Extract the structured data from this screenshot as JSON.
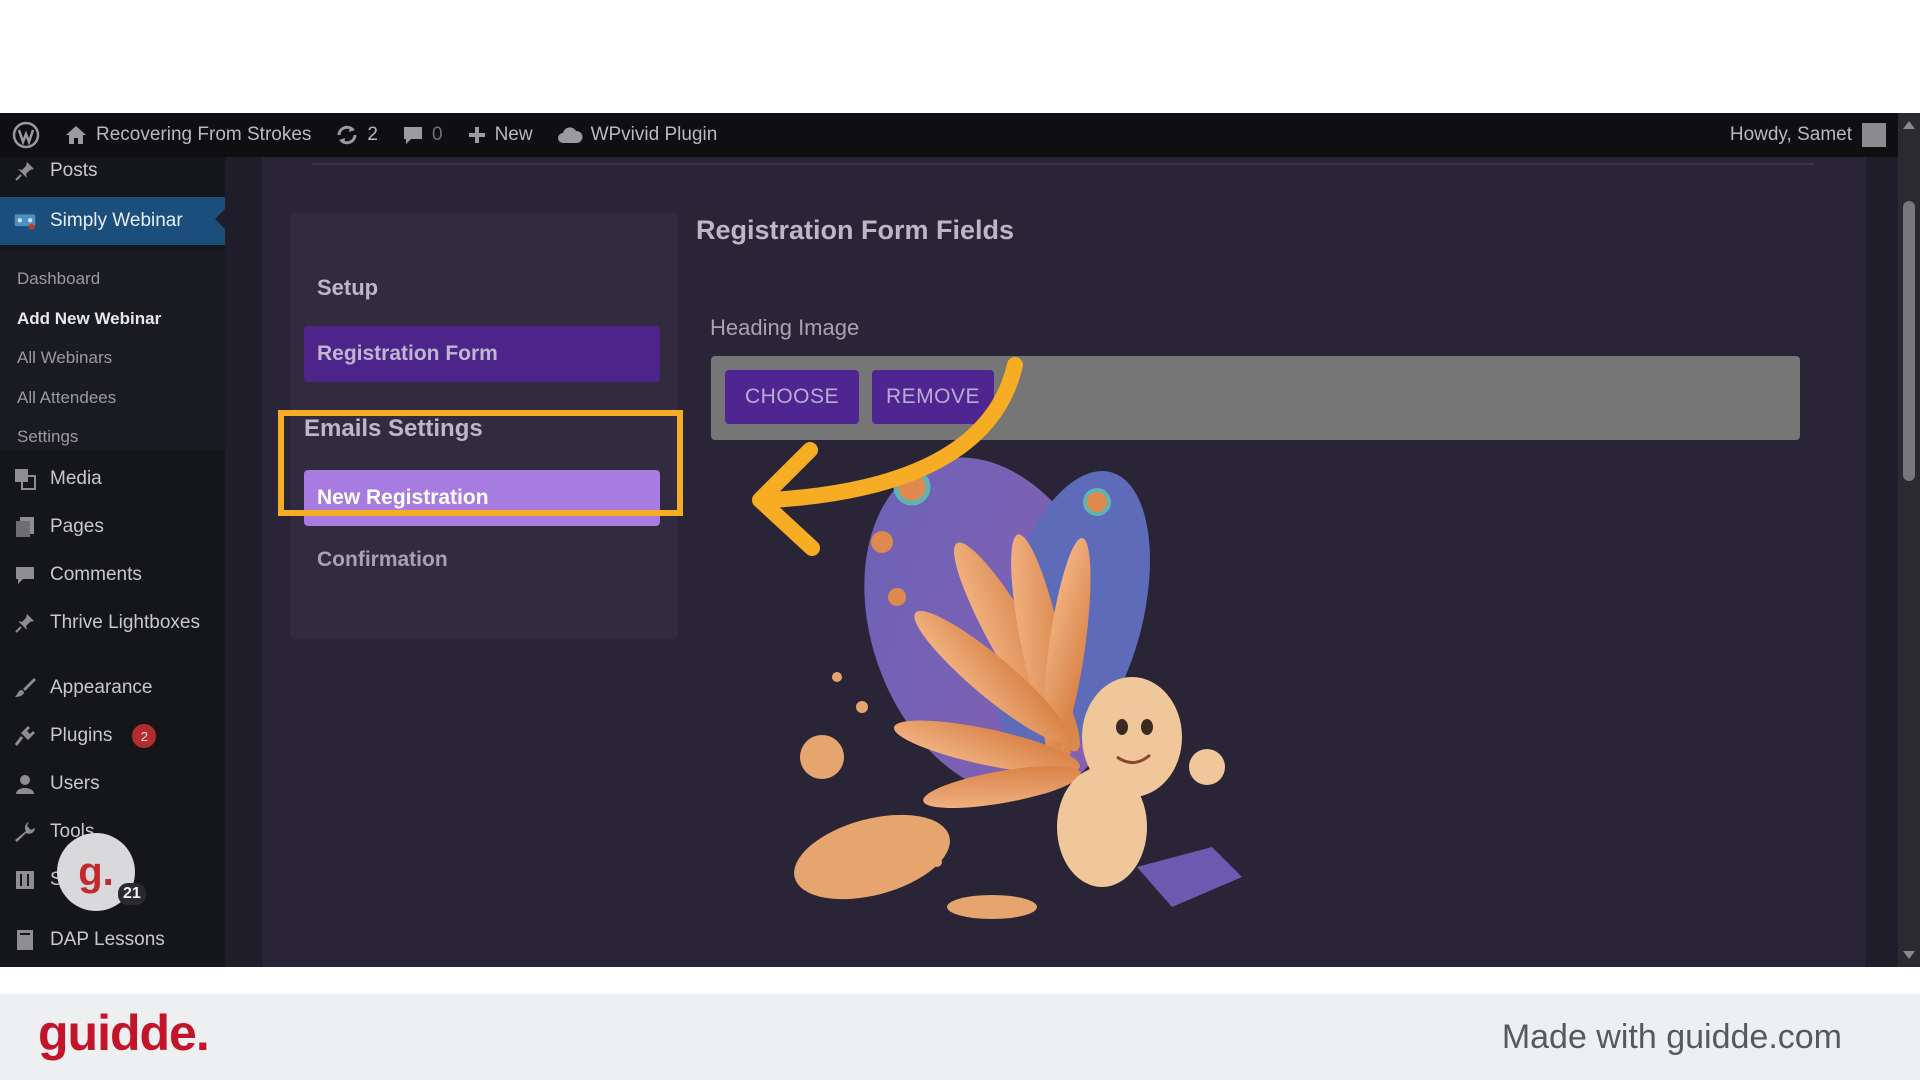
{
  "admin_bar": {
    "site_name": "Recovering From Strokes",
    "updates_count": "2",
    "comments_count": "0",
    "new_label": "New",
    "plugin_label": "WPvivid Plugin",
    "greeting": "Howdy, Samet"
  },
  "sidebar": {
    "posts": "Posts",
    "simply_webinar": "Simply Webinar",
    "submenu": [
      "Dashboard",
      "Add New Webinar",
      "All Webinars",
      "All Attendees",
      "Settings"
    ],
    "media": "Media",
    "pages": "Pages",
    "comments": "Comments",
    "thrive": "Thrive Lightboxes",
    "appearance": "Appearance",
    "plugins": "Plugins",
    "plugins_badge": "2",
    "users": "Users",
    "tools": "Tools",
    "settings_partial": "S",
    "dap": "DAP Lessons"
  },
  "guidde_avatar": {
    "letter": "g.",
    "count": "21"
  },
  "panel": {
    "setup": "Setup",
    "registration_form": "Registration Form",
    "emails_settings": "Emails Settings",
    "new_registration": "New Registration",
    "confirmation": "Confirmation"
  },
  "content": {
    "title": "Registration Form Fields",
    "heading_image_label": "Heading Image",
    "choose": "CHOOSE",
    "remove": "REMOVE"
  },
  "footer": {
    "brand": "guidde.",
    "made_with": "Made with guidde.com"
  },
  "colors": {
    "highlight": "#f6ad24",
    "active_menu": "#1c4e7c",
    "purple_dark": "#4d248a",
    "purple_light": "#a77be0",
    "brand_red": "#c3152a"
  }
}
